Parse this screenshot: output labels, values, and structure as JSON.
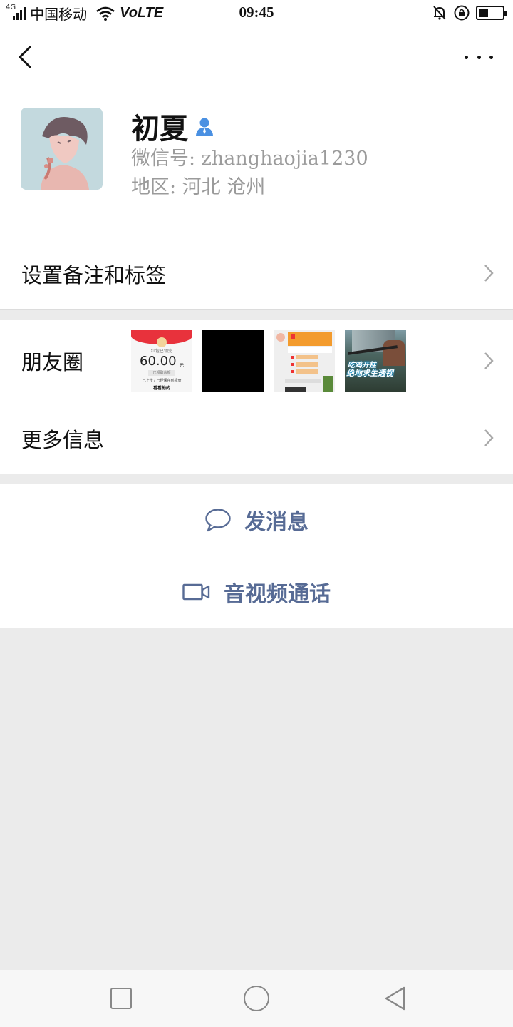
{
  "status_bar": {
    "network_type": "4G",
    "carrier": "中国移动",
    "volte": "VoLTE",
    "time": "09:45",
    "battery_level": 0.4
  },
  "nav": {
    "back_icon": "chevron-left-icon",
    "more_icon": "more-dots-icon"
  },
  "profile": {
    "name": "初夏",
    "wechat_id_label": "微信号: zhanghaojia1230",
    "region_label": "地区: 河北  沧州"
  },
  "rows": {
    "remark": "设置备注和标签",
    "moments": "朋友圈",
    "more_info": "更多信息"
  },
  "moments_thumbs": [
    {
      "id": "thumb-red-packet",
      "top_text": "红包已领完",
      "amount": "60.00",
      "unit": "元",
      "button_text": "已领取余额",
      "line1": "已上传 / 已经保存到相册",
      "line2": "看看他的"
    },
    {
      "id": "thumb-black"
    },
    {
      "id": "thumb-chat-screenshot"
    },
    {
      "id": "thumb-game-screenshot",
      "caption_line1": "吃鸡开挂",
      "caption_line2": "绝地求生透视"
    }
  ],
  "actions": {
    "send_message": "发消息",
    "video_call": "音视频通话"
  },
  "colors": {
    "link_blue": "#576b95",
    "secondary_text": "#9b9b9b",
    "page_bg": "#ebebeb",
    "contact_icon_blue": "#4a90e2"
  }
}
